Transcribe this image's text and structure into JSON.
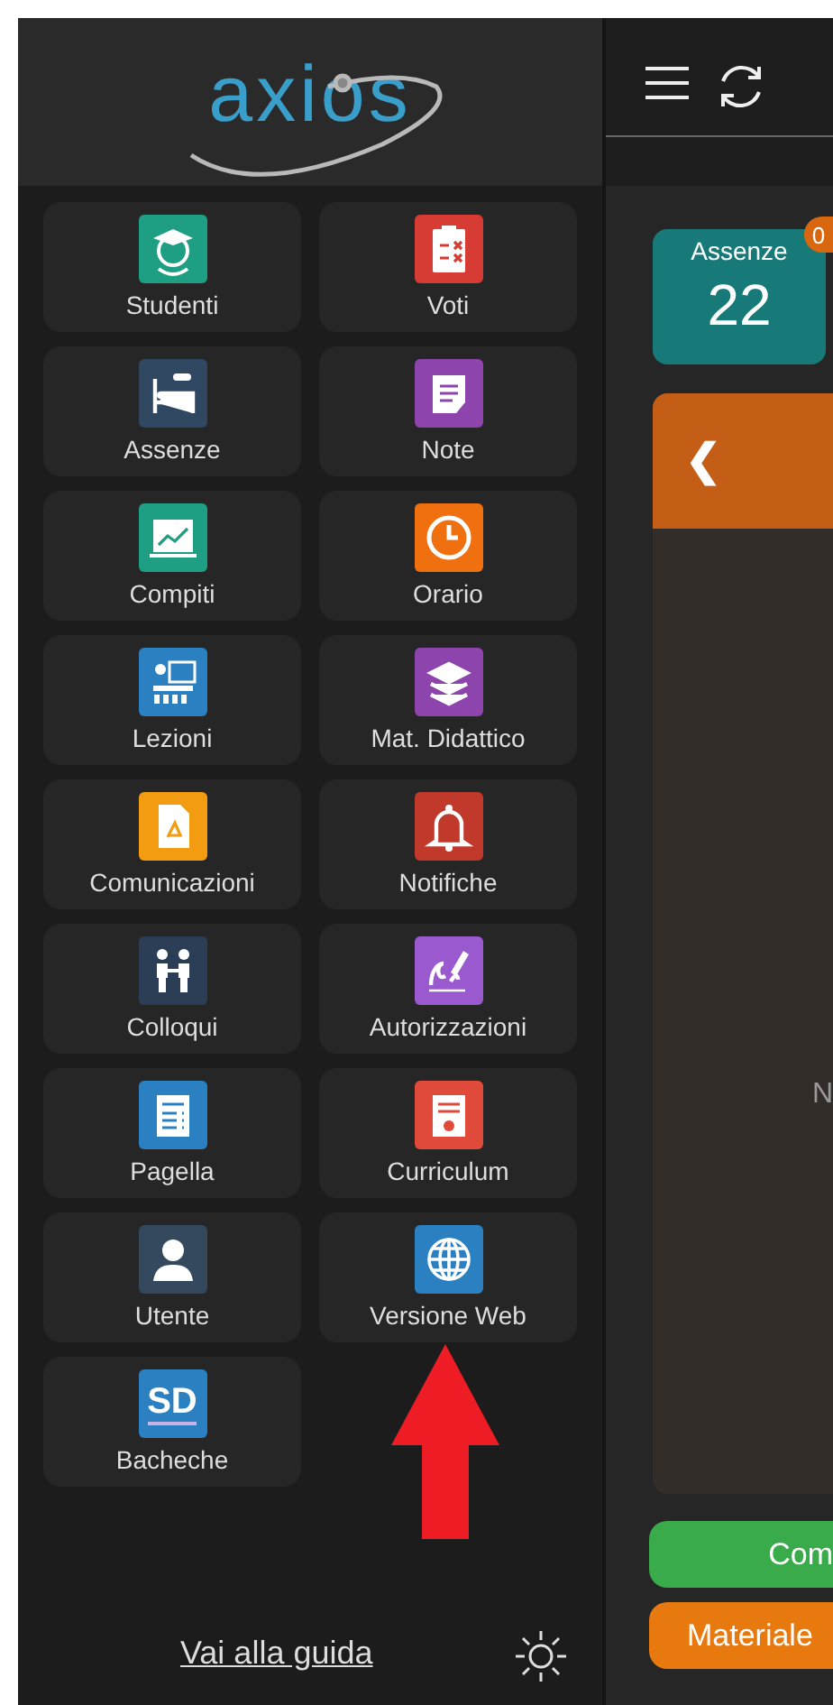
{
  "logo": {
    "text": "axios"
  },
  "menu": [
    {
      "label": "Studenti",
      "kind": "student",
      "color": "#1e9e82"
    },
    {
      "label": "Voti",
      "kind": "clipboard",
      "color": "#d63c33"
    },
    {
      "label": "Assenze",
      "kind": "bed",
      "color": "#2f4760"
    },
    {
      "label": "Note",
      "kind": "note",
      "color": "#8e44ad"
    },
    {
      "label": "Compiti",
      "kind": "chart",
      "color": "#1e9e82"
    },
    {
      "label": "Orario",
      "kind": "clock",
      "color": "#f07010"
    },
    {
      "label": "Lezioni",
      "kind": "lesson",
      "color": "#2a80c0"
    },
    {
      "label": "Mat. Didattico",
      "kind": "books",
      "color": "#8e44ad"
    },
    {
      "label": "Comunicazioni",
      "kind": "pdf",
      "color": "#f39c12"
    },
    {
      "label": "Notifiche",
      "kind": "bell",
      "color": "#c0392b"
    },
    {
      "label": "Colloqui",
      "kind": "people",
      "color": "#2c3e55"
    },
    {
      "label": "Autorizzazioni",
      "kind": "signature",
      "color": "#9b59d0"
    },
    {
      "label": "Pagella",
      "kind": "document",
      "color": "#2a80c0"
    },
    {
      "label": "Curriculum",
      "kind": "certificate",
      "color": "#e04a3a"
    },
    {
      "label": "Utente",
      "kind": "user",
      "color": "#34495e"
    },
    {
      "label": "Versione Web",
      "kind": "globe",
      "color": "#2a80c0"
    },
    {
      "label": "Bacheche",
      "kind": "text",
      "icon_text": "SD",
      "color": "#2a80c0"
    }
  ],
  "footer": {
    "link": "Vai alla guida"
  },
  "summary_card": {
    "label": "Assenze",
    "value": "22",
    "badge": "0"
  },
  "panel": {
    "prev": "❮",
    "text": "N"
  },
  "buttons": [
    {
      "label": "Com",
      "color": "#3aab4a"
    },
    {
      "label": "Materiale",
      "color": "#e8790f"
    }
  ]
}
